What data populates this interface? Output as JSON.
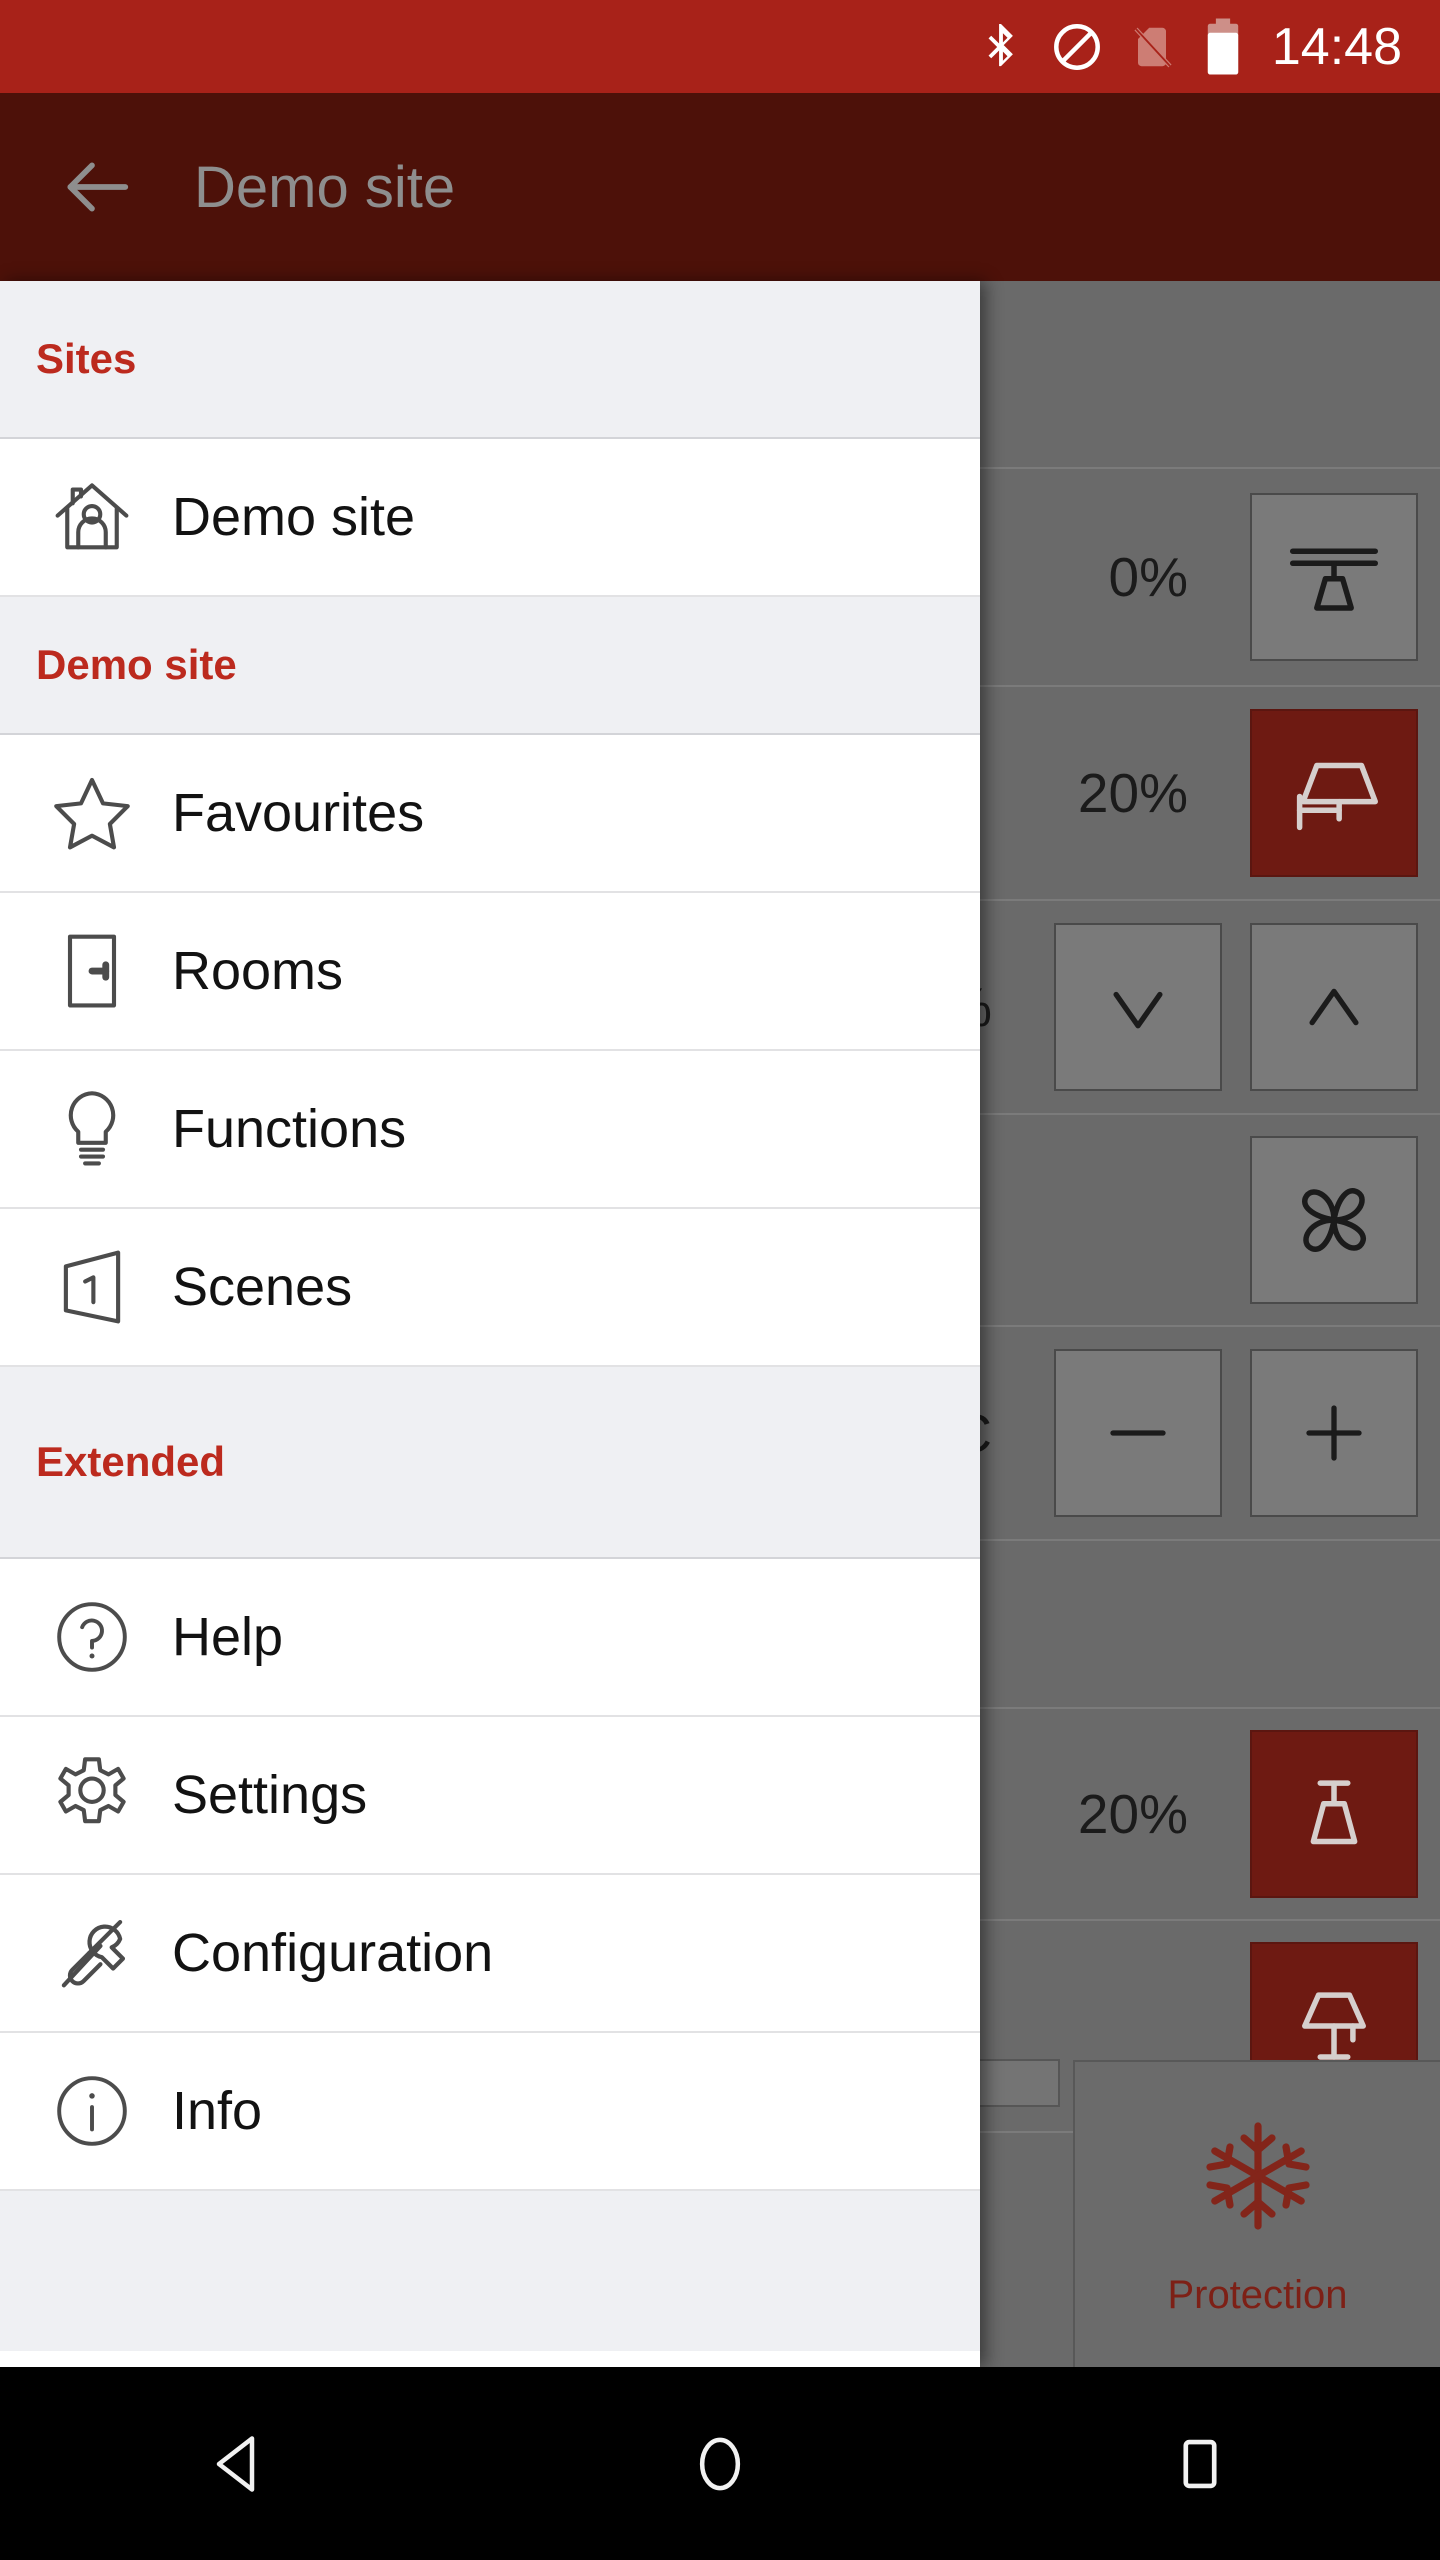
{
  "status_bar": {
    "time": "14:48",
    "icons": [
      "bluetooth-icon",
      "do-not-disturb-icon",
      "no-sim-icon",
      "battery-icon"
    ]
  },
  "app_bar": {
    "back_icon": "back-arrow-icon",
    "title": "Demo site"
  },
  "drawer": {
    "sections": [
      {
        "header": "Sites",
        "items": [
          {
            "label": "Demo site",
            "icon": "house-person-icon"
          }
        ]
      },
      {
        "header": "Demo site",
        "items": [
          {
            "label": "Favourites",
            "icon": "star-icon"
          },
          {
            "label": "Rooms",
            "icon": "door-icon"
          },
          {
            "label": "Functions",
            "icon": "lightbulb-icon"
          },
          {
            "label": "Scenes",
            "icon": "scene-panel-icon"
          }
        ]
      },
      {
        "header": "Extended",
        "items": [
          {
            "label": "Help",
            "icon": "question-circle-icon"
          },
          {
            "label": "Settings",
            "icon": "gear-icon"
          },
          {
            "label": "Configuration",
            "icon": "screwdriver-wrench-icon"
          },
          {
            "label": "Info",
            "icon": "info-circle-icon"
          }
        ]
      }
    ]
  },
  "background": {
    "rows": [
      {
        "percent": "",
        "tiles": []
      },
      {
        "percent": "0%",
        "tiles": [
          {
            "icon": "ceiling-lamp-icon",
            "state": "off"
          }
        ]
      },
      {
        "percent": "20%",
        "tiles": [
          {
            "icon": "wall-lamp-icon",
            "state": "on"
          }
        ]
      },
      {
        "percent": "%",
        "tiles": [
          {
            "icon": "chevron-down-icon",
            "state": "off"
          },
          {
            "icon": "chevron-up-icon",
            "state": "off"
          }
        ]
      },
      {
        "percent": "",
        "tiles": [
          {
            "icon": "fan-icon",
            "state": "off"
          }
        ]
      },
      {
        "percent": "C",
        "tiles": [
          {
            "icon": "minus-icon",
            "state": "off"
          },
          {
            "icon": "plus-icon",
            "state": "off"
          }
        ]
      },
      {
        "percent": "",
        "tiles": []
      },
      {
        "percent": "20%",
        "tiles": [
          {
            "icon": "pendant-lamp-icon",
            "state": "on"
          }
        ]
      },
      {
        "percent": "",
        "tiles": [
          {
            "icon": "table-lamp-icon",
            "state": "on"
          }
        ]
      }
    ],
    "protection_tile": {
      "label": "Protection",
      "icon": "snowflake-icon"
    }
  },
  "nav_bar": {
    "buttons": [
      {
        "name": "back-triangle-icon"
      },
      {
        "name": "home-circle-icon"
      },
      {
        "name": "recents-square-icon"
      }
    ]
  },
  "colors": {
    "status_bar": "#a82219",
    "app_bar": "#4d1109",
    "accent_red": "#bc2a1e",
    "tile_on": "#6e1a12",
    "scrim": "#6a6a6a",
    "section_bg": "#eff0f3"
  }
}
